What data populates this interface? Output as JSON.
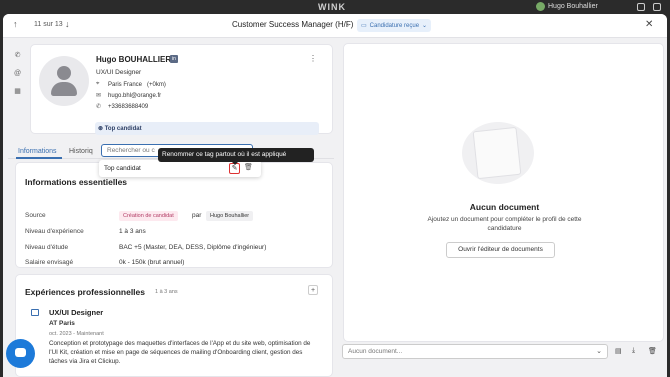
{
  "app": {
    "logo": "WINK",
    "user_name": "Hugo Bouhallier"
  },
  "header": {
    "position": "11 sur 13",
    "job_title": "Customer Success Manager (H/F)",
    "status": "Candidature reçue"
  },
  "profile": {
    "name": "Hugo BOUHALLIER",
    "role": "UX/UI Designer",
    "location": "Paris France",
    "distance": "(+0km)",
    "email": "hugo.bhl@orange.fr",
    "phone": "+33683688409",
    "tag": "Top candidat"
  },
  "tabs": {
    "informations": "Informations",
    "historique": "Historiq"
  },
  "tag_search": {
    "placeholder": "Rechercher ou c"
  },
  "dropdown": {
    "item": "Top candidat"
  },
  "tooltip": "Renommer ce tag partout où il est appliqué",
  "essentials": {
    "title": "Informations essentielles",
    "source_label": "Source",
    "source_value": "Création de candidat",
    "par": "par",
    "by": "Hugo Bouhallier",
    "experience_label": "Niveau d'expérience",
    "experience_value": "1 à 3 ans",
    "education_label": "Niveau d'étude",
    "education_value": "BAC +5 (Master, DEA, DESS, Diplôme d'ingénieur)",
    "salary_label": "Salaire envisagé",
    "salary_value": "0k - 150k (brut annuel)"
  },
  "experiences": {
    "title": "Expériences professionnelles",
    "duration": "1 à 3 ans",
    "items": [
      {
        "title": "UX/UI Designer",
        "company": "AT Paris",
        "dates": "oct. 2023 - Maintenant",
        "description": "Conception et prototypage des maquettes d'interfaces de l'App et du site web, optimisation de l'UI Kit, création et mise en page de séquences de mailing d'Onboarding client, gestion des tâches via Jira et Clickup."
      }
    ]
  },
  "documents": {
    "title": "Aucun document",
    "subtitle": "Ajoutez un document pour compléter le profil de cette candidature",
    "button": "Ouvrir l'éditeur de documents",
    "select_placeholder": "Aucun document..."
  },
  "colors": {
    "accent": "#3a6fb0",
    "chat": "#1d7ad9"
  }
}
